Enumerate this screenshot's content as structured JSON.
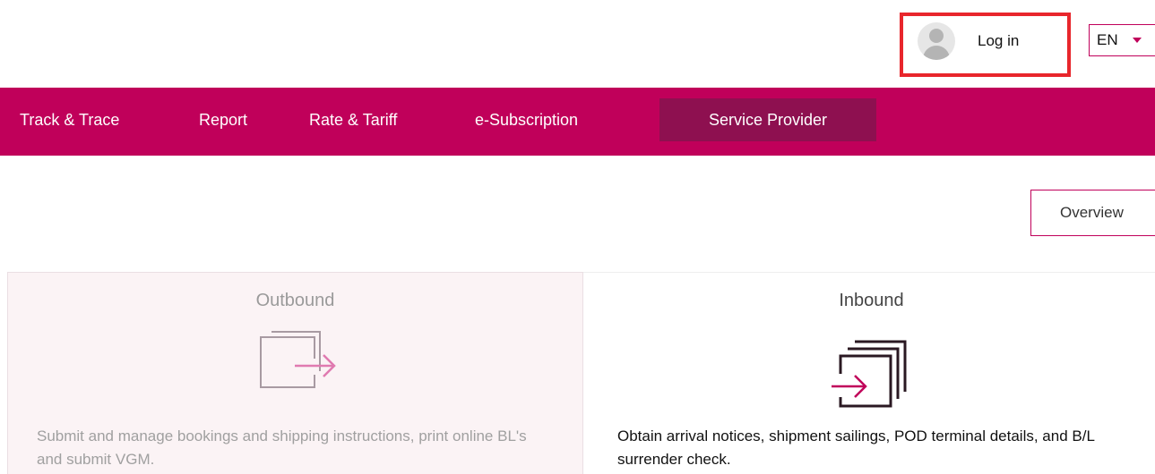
{
  "header": {
    "login_label": "Log in",
    "language": "EN"
  },
  "nav": {
    "items": [
      {
        "label": "Track & Trace"
      },
      {
        "label": "Report"
      },
      {
        "label": "Rate & Tariff"
      },
      {
        "label": "e-Subscription"
      },
      {
        "label": "Service Provider",
        "active": true
      }
    ]
  },
  "overview_label": "Overview",
  "cards": {
    "outbound": {
      "title": "Outbound",
      "description": "Submit and manage bookings and shipping instructions, print online BL's and submit VGM."
    },
    "inbound": {
      "title": "Inbound",
      "description": "Obtain arrival notices, shipment sailings, POD terminal details, and B/L surrender check."
    }
  },
  "colors": {
    "brand": "#c0005a",
    "nav_active": "#8e1050",
    "highlight": "#e8262c",
    "outbound_bg": "#fbf3f5",
    "icon_outbound_box": "#a89aa2",
    "icon_outbound_arrow": "#e07ab0",
    "icon_inbound_box": "#2a1822",
    "icon_inbound_arrow": "#c0005a"
  },
  "icons": {
    "login": "user-avatar-icon",
    "language": "chevron-down-icon",
    "outbound": "outbound-arrow-icon",
    "inbound": "inbound-arrow-icon"
  }
}
